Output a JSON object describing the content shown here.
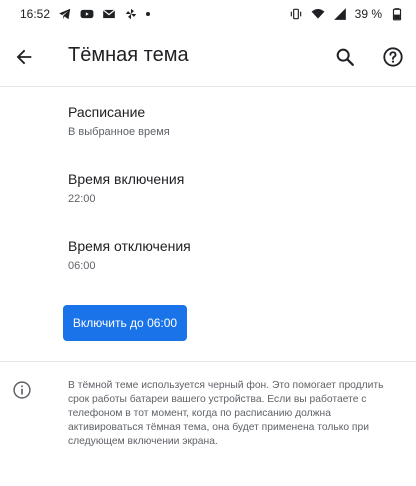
{
  "status_bar": {
    "time": "16:52",
    "battery_percent": "39 %",
    "icons_left": [
      "telegram-icon",
      "youtube-icon",
      "gmail-icon",
      "pinwheel-icon",
      "dot-icon"
    ],
    "icons_right": [
      "vibrate-icon",
      "wifi-icon",
      "signal-icon",
      "battery-icon"
    ]
  },
  "app_bar": {
    "title": "Тёмная тема",
    "back_icon": "arrow-back-icon",
    "search_icon": "search-icon",
    "help_icon": "help-icon"
  },
  "preferences": [
    {
      "title": "Расписание",
      "summary": "В выбранное время"
    },
    {
      "title": "Время включения",
      "summary": "22:00"
    },
    {
      "title": "Время отключения",
      "summary": "06:00"
    }
  ],
  "action_button": {
    "label": "Включить до 06:00"
  },
  "footer": {
    "icon": "info-icon",
    "text": "В тёмной теме используется черный фон. Это помогает продлить срок работы батареи вашего устройства. Если вы работаете с телефоном в тот момент, когда по расписанию должна активироваться тёмная тема, она будет применена только при следующем включении экрана."
  },
  "colors": {
    "accent": "#1a73e8",
    "text_primary": "#202124",
    "text_secondary": "#5f6368"
  }
}
